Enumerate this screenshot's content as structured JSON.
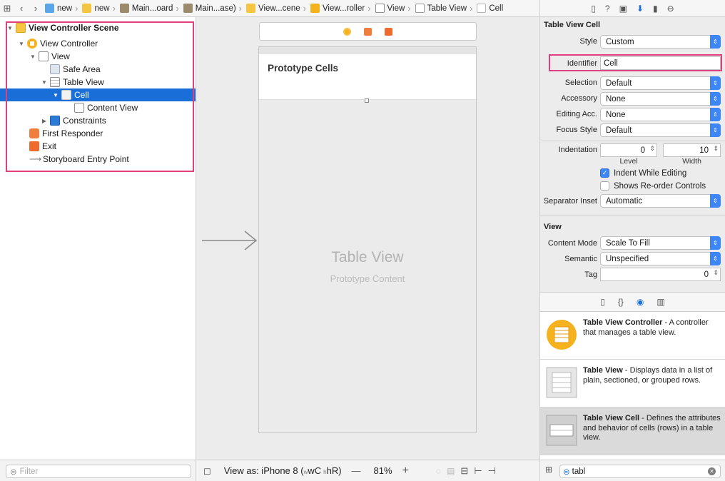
{
  "jumpbar": {
    "crumbs": [
      "new",
      "new",
      "Main...oard",
      "Main...ase)",
      "View...cene",
      "View...roller",
      "View",
      "Table View",
      "Cell"
    ]
  },
  "outline": {
    "rows": [
      {
        "label": "View Controller Scene"
      },
      {
        "label": "View Controller"
      },
      {
        "label": "View"
      },
      {
        "label": "Safe Area"
      },
      {
        "label": "Table View"
      },
      {
        "label": "Cell"
      },
      {
        "label": "Content View"
      },
      {
        "label": "Constraints"
      },
      {
        "label": "First Responder"
      },
      {
        "label": "Exit"
      },
      {
        "label": "Storyboard Entry Point"
      }
    ],
    "filter_placeholder": "Filter"
  },
  "canvas": {
    "prototype_cells_label": "Prototype Cells",
    "table_view_label": "Table View",
    "prototype_content_label": "Prototype Content",
    "view_as": "View as: iPhone 8 (",
    "size_class_w": "wC",
    "size_class_h": "hR)",
    "zoom_minus": "—",
    "zoom": "81%",
    "zoom_plus": "+"
  },
  "inspector": {
    "section_cell": "Table View Cell",
    "style_label": "Style",
    "style_value": "Custom",
    "identifier_label": "Identifier",
    "identifier_value": "Cell",
    "selection_label": "Selection",
    "selection_value": "Default",
    "accessory_label": "Accessory",
    "accessory_value": "None",
    "editing_acc_label": "Editing Acc.",
    "editing_acc_value": "None",
    "focus_style_label": "Focus Style",
    "focus_style_value": "Default",
    "indentation_label": "Indentation",
    "indent_level_value": "0",
    "indent_width_value": "10",
    "level_label": "Level",
    "width_label": "Width",
    "indent_while_editing": "Indent While Editing",
    "indent_while_editing_checked": true,
    "shows_reorder": "Shows Re-order Controls",
    "shows_reorder_checked": false,
    "separator_inset_label": "Separator Inset",
    "separator_inset_value": "Automatic",
    "section_view": "View",
    "content_mode_label": "Content Mode",
    "content_mode_value": "Scale To Fill",
    "semantic_label": "Semantic",
    "semantic_value": "Unspecified",
    "tag_label": "Tag",
    "tag_value": "0"
  },
  "library": {
    "items": [
      {
        "title": "Table View Controller",
        "desc": " - A controller that manages a table view."
      },
      {
        "title": "Table View",
        "desc": " - Displays data in a list of plain, sectioned, or grouped rows."
      },
      {
        "title": "Table View Cell",
        "desc": " - Defines the attributes and behavior of cells (rows) in a table view."
      }
    ],
    "search_value": "tabl"
  },
  "colors": {
    "selection": "#1a6ed8",
    "highlight_box": "#e0407d",
    "popup_accent": "#3e86f5"
  }
}
